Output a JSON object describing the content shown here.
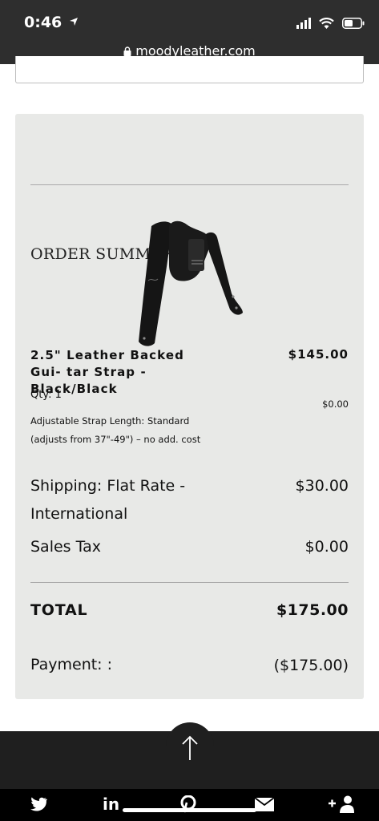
{
  "status_bar": {
    "time": "0:46",
    "url": "moodyleather.com"
  },
  "order_summary": {
    "title": "ORDER SUMMARY",
    "item": {
      "name": "2.5\" Leather Backed Gui- tar Strap - Black/Black",
      "price": "$145.00",
      "qty": "Qty: 1",
      "option": "Adjustable Strap Length: Standard (adjusts from 37\"-49\") – no add. cost",
      "option_price": "$0.00"
    },
    "shipping": {
      "label": "Shipping: Flat Rate - International",
      "value": "$30.00"
    },
    "sales_tax": {
      "label": "Sales Tax",
      "value": "$0.00"
    },
    "total": {
      "label": "TOTAL",
      "value": "$175.00"
    },
    "payment": {
      "label": "Payment: :",
      "value": "($175.00)"
    }
  },
  "footer": {
    "social_icons": [
      "twitter-icon",
      "linkedin-icon",
      "pinterest-icon",
      "email-icon",
      "add-contact-icon"
    ],
    "linkedin_text": "in"
  }
}
